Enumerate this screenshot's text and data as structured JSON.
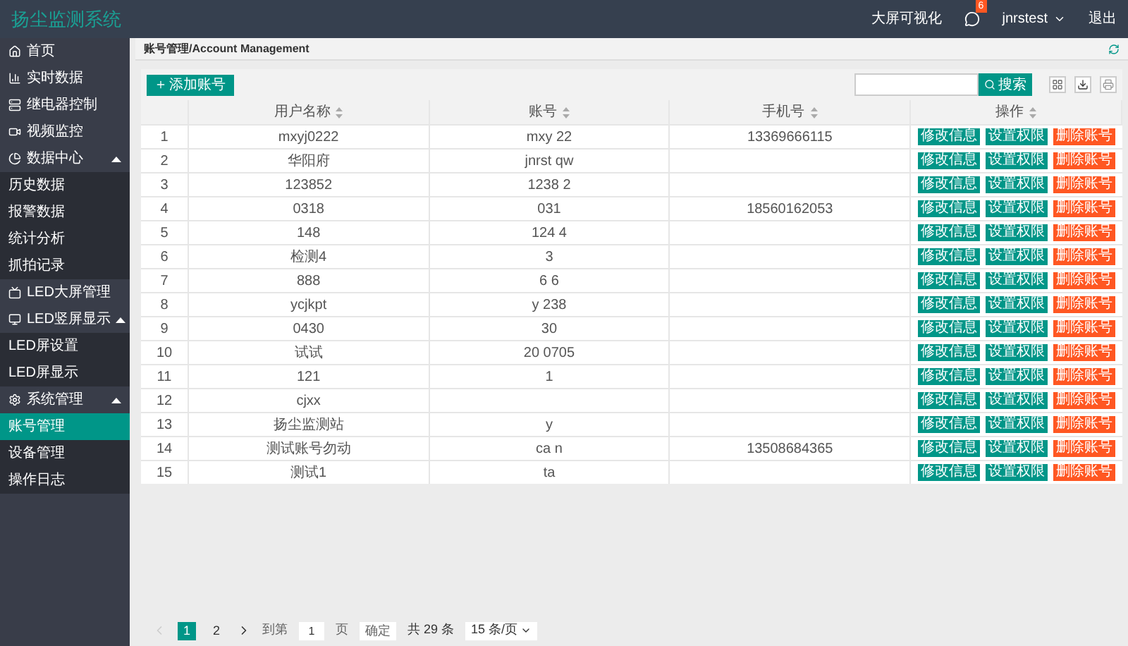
{
  "header": {
    "title": "扬尘监测系统",
    "link": "大屏可视化",
    "badge": "6",
    "user": "jnrstest",
    "logout": "退出"
  },
  "sidebar": {
    "items": [
      {
        "label": "首页",
        "kind": "home",
        "selected": false
      },
      {
        "label": "实时数据",
        "kind": "chart",
        "selected": false
      },
      {
        "label": "继电器控制",
        "kind": "relay",
        "selected": false
      },
      {
        "label": "视频监控",
        "kind": "video",
        "selected": false
      },
      {
        "label": "数据中心",
        "kind": "pie",
        "selected": false,
        "expanded": true,
        "children": [
          {
            "label": "历史数据",
            "selected": false
          },
          {
            "label": "报警数据",
            "selected": false
          },
          {
            "label": "统计分析",
            "selected": false
          },
          {
            "label": "抓拍记录",
            "selected": false
          }
        ]
      },
      {
        "label": "LED大屏管理",
        "kind": "led",
        "selected": false
      },
      {
        "label": "LED竖屏显示",
        "kind": "monitor",
        "selected": false,
        "expanded": true,
        "children": [
          {
            "label": "LED屏设置",
            "selected": false
          },
          {
            "label": "LED屏显示",
            "selected": false
          }
        ]
      },
      {
        "label": "系统管理",
        "kind": "cogs",
        "selected": false,
        "expanded": true,
        "children": [
          {
            "label": "账号管理",
            "selected": true
          },
          {
            "label": "设备管理",
            "selected": false
          },
          {
            "label": "操作日志",
            "selected": false
          }
        ]
      }
    ]
  },
  "breadcrumb": "账号管理/Account Management",
  "toolbar": {
    "add_button": "添加账号",
    "search_button": "搜索"
  },
  "table": {
    "columns": [
      {
        "sortable": false
      },
      {
        "label": "用户名称",
        "sortable": true
      },
      {
        "label": "账号",
        "sortable": true
      },
      {
        "label": "手机号",
        "sortable": true
      },
      {
        "label": "操作",
        "sortable": true
      }
    ],
    "rows": [
      {
        "index": "1",
        "username": "mxyj0222",
        "account": "mxy 22",
        "phone": "13369666115",
        "actions": [
          {
            "label": "修改信息",
            "kind": "edit"
          },
          {
            "label": "设置权限",
            "kind": "permission"
          },
          {
            "label": "删除账号",
            "kind": "delete"
          }
        ]
      },
      {
        "index": "2",
        "username": "华阳府",
        "account": "jnrst qw",
        "actions": [
          {
            "label": "修改信息",
            "kind": "edit"
          },
          {
            "label": "设置权限",
            "kind": "permission"
          },
          {
            "label": "删除账号",
            "kind": "delete"
          }
        ]
      },
      {
        "index": "3",
        "username": "123852",
        "account": "1238 2",
        "actions": [
          {
            "label": "修改信息",
            "kind": "edit"
          },
          {
            "label": "设置权限",
            "kind": "permission"
          },
          {
            "label": "删除账号",
            "kind": "delete"
          }
        ]
      },
      {
        "index": "4",
        "username": "0318",
        "account": "031",
        "phone": "18560162053",
        "actions": [
          {
            "label": "修改信息",
            "kind": "edit"
          },
          {
            "label": "设置权限",
            "kind": "permission"
          },
          {
            "label": "删除账号",
            "kind": "delete"
          }
        ]
      },
      {
        "index": "5",
        "username": "148",
        "account": "124 4",
        "actions": [
          {
            "label": "修改信息",
            "kind": "edit"
          },
          {
            "label": "设置权限",
            "kind": "permission"
          },
          {
            "label": "删除账号",
            "kind": "delete"
          }
        ]
      },
      {
        "index": "6",
        "username": "检测4",
        "account": "3",
        "actions": [
          {
            "label": "修改信息",
            "kind": "edit"
          },
          {
            "label": "设置权限",
            "kind": "permission"
          },
          {
            "label": "删除账号",
            "kind": "delete"
          }
        ]
      },
      {
        "index": "7",
        "username": "888",
        "account": "6 6",
        "actions": [
          {
            "label": "修改信息",
            "kind": "edit"
          },
          {
            "label": "设置权限",
            "kind": "permission"
          },
          {
            "label": "删除账号",
            "kind": "delete"
          }
        ]
      },
      {
        "index": "8",
        "username": "ycjkpt",
        "account": "y 238",
        "actions": [
          {
            "label": "修改信息",
            "kind": "edit"
          },
          {
            "label": "设置权限",
            "kind": "permission"
          },
          {
            "label": "删除账号",
            "kind": "delete"
          }
        ]
      },
      {
        "index": "9",
        "username": "0430",
        "account": "30",
        "actions": [
          {
            "label": "修改信息",
            "kind": "edit"
          },
          {
            "label": "设置权限",
            "kind": "permission"
          },
          {
            "label": "删除账号",
            "kind": "delete"
          }
        ]
      },
      {
        "index": "10",
        "username": "试试",
        "account": "20 0705",
        "actions": [
          {
            "label": "修改信息",
            "kind": "edit"
          },
          {
            "label": "设置权限",
            "kind": "permission"
          },
          {
            "label": "删除账号",
            "kind": "delete"
          }
        ]
      },
      {
        "index": "11",
        "username": "121",
        "account": "1",
        "actions": [
          {
            "label": "修改信息",
            "kind": "edit"
          },
          {
            "label": "设置权限",
            "kind": "permission"
          },
          {
            "label": "删除账号",
            "kind": "delete"
          }
        ]
      },
      {
        "index": "12",
        "username": "cjxx",
        "actions": [
          {
            "label": "修改信息",
            "kind": "edit"
          },
          {
            "label": "设置权限",
            "kind": "permission"
          },
          {
            "label": "删除账号",
            "kind": "delete"
          }
        ]
      },
      {
        "index": "13",
        "username": "扬尘监测站",
        "account": "y",
        "actions": [
          {
            "label": "修改信息",
            "kind": "edit"
          },
          {
            "label": "设置权限",
            "kind": "permission"
          },
          {
            "label": "删除账号",
            "kind": "delete"
          }
        ]
      },
      {
        "index": "14",
        "username": "测试账号勿动",
        "account": "ca n",
        "phone": "13508684365",
        "actions": [
          {
            "label": "修改信息",
            "kind": "edit"
          },
          {
            "label": "设置权限",
            "kind": "permission"
          },
          {
            "label": "删除账号",
            "kind": "delete"
          }
        ]
      },
      {
        "index": "15",
        "username": "测试1",
        "account": "ta",
        "actions": [
          {
            "label": "修改信息",
            "kind": "edit"
          },
          {
            "label": "设置权限",
            "kind": "permission"
          },
          {
            "label": "删除账号",
            "kind": "delete"
          }
        ]
      }
    ]
  },
  "pagination": {
    "pages": [
      {
        "label": "1",
        "selected": true
      },
      {
        "label": "2",
        "selected": false
      }
    ],
    "goto_label": "到第",
    "page_value": "1",
    "page_unit": "页",
    "confirm": "确定",
    "total": "共 29 条",
    "page_size": "15 条/页"
  }
}
